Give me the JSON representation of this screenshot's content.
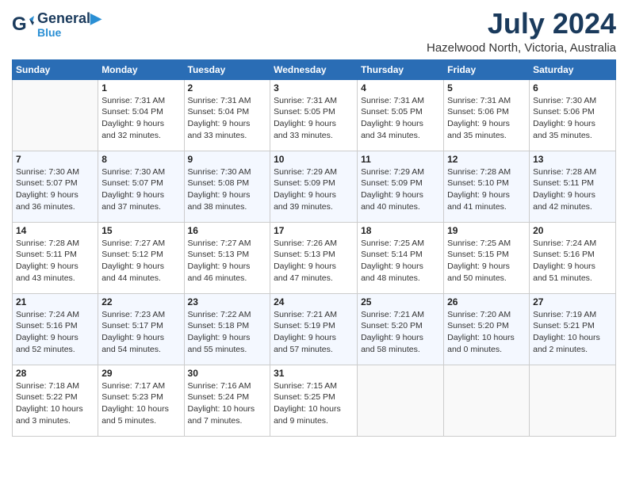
{
  "header": {
    "logo_line1": "General",
    "logo_line2": "Blue",
    "month": "July 2024",
    "location": "Hazelwood North, Victoria, Australia"
  },
  "weekdays": [
    "Sunday",
    "Monday",
    "Tuesday",
    "Wednesday",
    "Thursday",
    "Friday",
    "Saturday"
  ],
  "weeks": [
    [
      {
        "day": "",
        "lines": []
      },
      {
        "day": "1",
        "lines": [
          "Sunrise: 7:31 AM",
          "Sunset: 5:04 PM",
          "Daylight: 9 hours",
          "and 32 minutes."
        ]
      },
      {
        "day": "2",
        "lines": [
          "Sunrise: 7:31 AM",
          "Sunset: 5:04 PM",
          "Daylight: 9 hours",
          "and 33 minutes."
        ]
      },
      {
        "day": "3",
        "lines": [
          "Sunrise: 7:31 AM",
          "Sunset: 5:05 PM",
          "Daylight: 9 hours",
          "and 33 minutes."
        ]
      },
      {
        "day": "4",
        "lines": [
          "Sunrise: 7:31 AM",
          "Sunset: 5:05 PM",
          "Daylight: 9 hours",
          "and 34 minutes."
        ]
      },
      {
        "day": "5",
        "lines": [
          "Sunrise: 7:31 AM",
          "Sunset: 5:06 PM",
          "Daylight: 9 hours",
          "and 35 minutes."
        ]
      },
      {
        "day": "6",
        "lines": [
          "Sunrise: 7:30 AM",
          "Sunset: 5:06 PM",
          "Daylight: 9 hours",
          "and 35 minutes."
        ]
      }
    ],
    [
      {
        "day": "7",
        "lines": [
          "Sunrise: 7:30 AM",
          "Sunset: 5:07 PM",
          "Daylight: 9 hours",
          "and 36 minutes."
        ]
      },
      {
        "day": "8",
        "lines": [
          "Sunrise: 7:30 AM",
          "Sunset: 5:07 PM",
          "Daylight: 9 hours",
          "and 37 minutes."
        ]
      },
      {
        "day": "9",
        "lines": [
          "Sunrise: 7:30 AM",
          "Sunset: 5:08 PM",
          "Daylight: 9 hours",
          "and 38 minutes."
        ]
      },
      {
        "day": "10",
        "lines": [
          "Sunrise: 7:29 AM",
          "Sunset: 5:09 PM",
          "Daylight: 9 hours",
          "and 39 minutes."
        ]
      },
      {
        "day": "11",
        "lines": [
          "Sunrise: 7:29 AM",
          "Sunset: 5:09 PM",
          "Daylight: 9 hours",
          "and 40 minutes."
        ]
      },
      {
        "day": "12",
        "lines": [
          "Sunrise: 7:28 AM",
          "Sunset: 5:10 PM",
          "Daylight: 9 hours",
          "and 41 minutes."
        ]
      },
      {
        "day": "13",
        "lines": [
          "Sunrise: 7:28 AM",
          "Sunset: 5:11 PM",
          "Daylight: 9 hours",
          "and 42 minutes."
        ]
      }
    ],
    [
      {
        "day": "14",
        "lines": [
          "Sunrise: 7:28 AM",
          "Sunset: 5:11 PM",
          "Daylight: 9 hours",
          "and 43 minutes."
        ]
      },
      {
        "day": "15",
        "lines": [
          "Sunrise: 7:27 AM",
          "Sunset: 5:12 PM",
          "Daylight: 9 hours",
          "and 44 minutes."
        ]
      },
      {
        "day": "16",
        "lines": [
          "Sunrise: 7:27 AM",
          "Sunset: 5:13 PM",
          "Daylight: 9 hours",
          "and 46 minutes."
        ]
      },
      {
        "day": "17",
        "lines": [
          "Sunrise: 7:26 AM",
          "Sunset: 5:13 PM",
          "Daylight: 9 hours",
          "and 47 minutes."
        ]
      },
      {
        "day": "18",
        "lines": [
          "Sunrise: 7:25 AM",
          "Sunset: 5:14 PM",
          "Daylight: 9 hours",
          "and 48 minutes."
        ]
      },
      {
        "day": "19",
        "lines": [
          "Sunrise: 7:25 AM",
          "Sunset: 5:15 PM",
          "Daylight: 9 hours",
          "and 50 minutes."
        ]
      },
      {
        "day": "20",
        "lines": [
          "Sunrise: 7:24 AM",
          "Sunset: 5:16 PM",
          "Daylight: 9 hours",
          "and 51 minutes."
        ]
      }
    ],
    [
      {
        "day": "21",
        "lines": [
          "Sunrise: 7:24 AM",
          "Sunset: 5:16 PM",
          "Daylight: 9 hours",
          "and 52 minutes."
        ]
      },
      {
        "day": "22",
        "lines": [
          "Sunrise: 7:23 AM",
          "Sunset: 5:17 PM",
          "Daylight: 9 hours",
          "and 54 minutes."
        ]
      },
      {
        "day": "23",
        "lines": [
          "Sunrise: 7:22 AM",
          "Sunset: 5:18 PM",
          "Daylight: 9 hours",
          "and 55 minutes."
        ]
      },
      {
        "day": "24",
        "lines": [
          "Sunrise: 7:21 AM",
          "Sunset: 5:19 PM",
          "Daylight: 9 hours",
          "and 57 minutes."
        ]
      },
      {
        "day": "25",
        "lines": [
          "Sunrise: 7:21 AM",
          "Sunset: 5:20 PM",
          "Daylight: 9 hours",
          "and 58 minutes."
        ]
      },
      {
        "day": "26",
        "lines": [
          "Sunrise: 7:20 AM",
          "Sunset: 5:20 PM",
          "Daylight: 10 hours",
          "and 0 minutes."
        ]
      },
      {
        "day": "27",
        "lines": [
          "Sunrise: 7:19 AM",
          "Sunset: 5:21 PM",
          "Daylight: 10 hours",
          "and 2 minutes."
        ]
      }
    ],
    [
      {
        "day": "28",
        "lines": [
          "Sunrise: 7:18 AM",
          "Sunset: 5:22 PM",
          "Daylight: 10 hours",
          "and 3 minutes."
        ]
      },
      {
        "day": "29",
        "lines": [
          "Sunrise: 7:17 AM",
          "Sunset: 5:23 PM",
          "Daylight: 10 hours",
          "and 5 minutes."
        ]
      },
      {
        "day": "30",
        "lines": [
          "Sunrise: 7:16 AM",
          "Sunset: 5:24 PM",
          "Daylight: 10 hours",
          "and 7 minutes."
        ]
      },
      {
        "day": "31",
        "lines": [
          "Sunrise: 7:15 AM",
          "Sunset: 5:25 PM",
          "Daylight: 10 hours",
          "and 9 minutes."
        ]
      },
      {
        "day": "",
        "lines": []
      },
      {
        "day": "",
        "lines": []
      },
      {
        "day": "",
        "lines": []
      }
    ]
  ]
}
